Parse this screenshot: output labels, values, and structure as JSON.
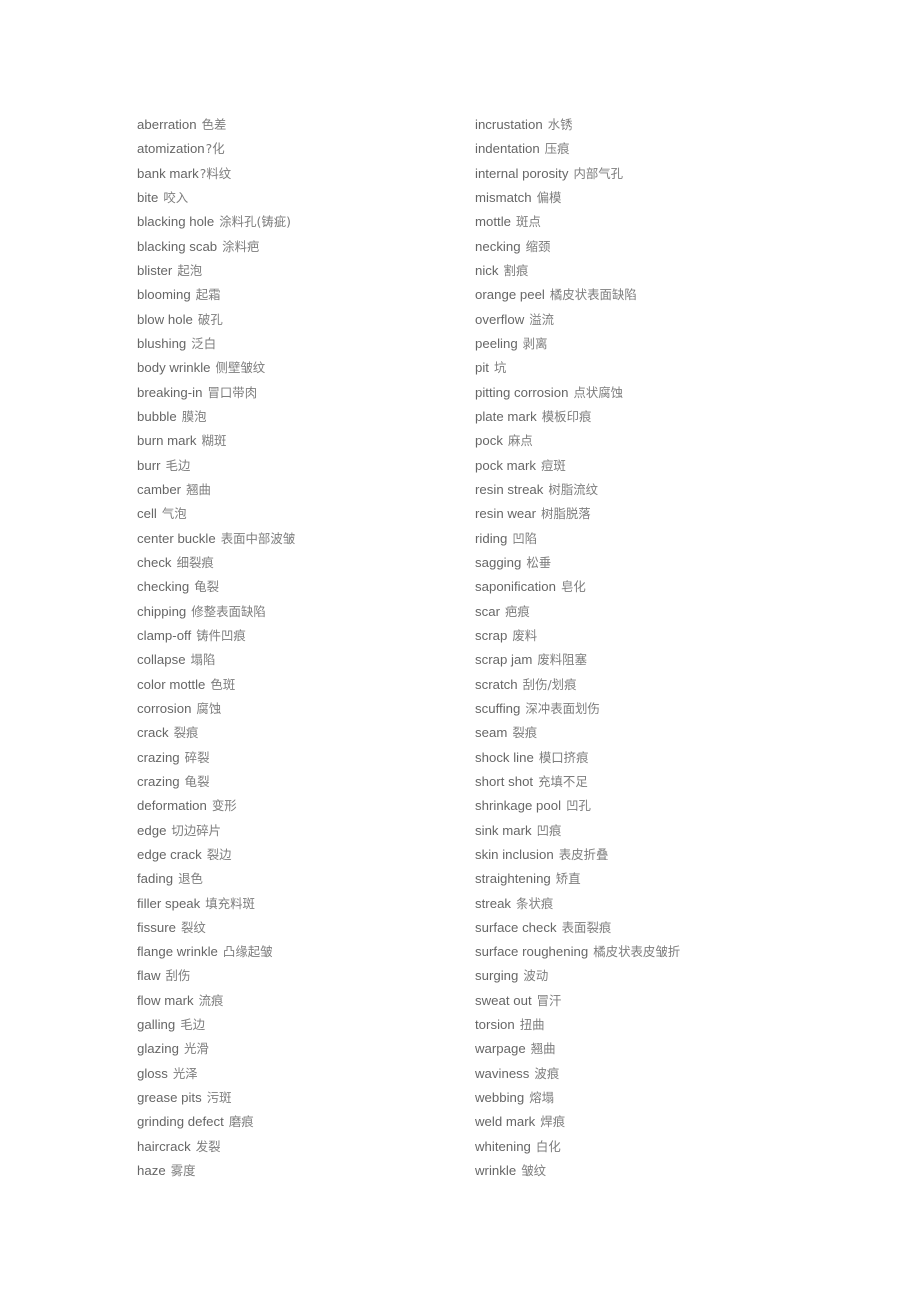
{
  "document": {
    "type": "bilingual-glossary",
    "language_pair": "English-Chinese",
    "columns": 2,
    "rows_per_column": 43,
    "text_color": "#666666",
    "background_color": "#ffffff"
  },
  "glossary": {
    "left_column": [
      {
        "term": "aberration",
        "gloss": "色差"
      },
      {
        "term": "atomization",
        "gloss": "?化",
        "tight": true
      },
      {
        "term": "bank mark",
        "gloss": "?料纹",
        "tight": true
      },
      {
        "term": "bite",
        "gloss": "咬入"
      },
      {
        "term": "blacking hole",
        "gloss": "涂料孔(铸疵)"
      },
      {
        "term": "blacking scab",
        "gloss": "涂料疤"
      },
      {
        "term": "blister",
        "gloss": "起泡"
      },
      {
        "term": "blooming",
        "gloss": "起霜"
      },
      {
        "term": "blow hole",
        "gloss": "破孔"
      },
      {
        "term": "blushing",
        "gloss": "泛白"
      },
      {
        "term": "body wrinkle",
        "gloss": "侧壁皱纹"
      },
      {
        "term": "breaking-in",
        "gloss": "冒口带肉"
      },
      {
        "term": "bubble",
        "gloss": "膜泡"
      },
      {
        "term": "burn mark",
        "gloss": "糊斑"
      },
      {
        "term": "burr",
        "gloss": "毛边"
      },
      {
        "term": "camber",
        "gloss": "翘曲"
      },
      {
        "term": "cell",
        "gloss": "气泡"
      },
      {
        "term": "center buckle",
        "gloss": "表面中部波皱"
      },
      {
        "term": "check",
        "gloss": "细裂痕"
      },
      {
        "term": "checking",
        "gloss": "龟裂"
      },
      {
        "term": "chipping",
        "gloss": "修整表面缺陷"
      },
      {
        "term": "clamp-off",
        "gloss": "铸件凹痕"
      },
      {
        "term": "collapse",
        "gloss": "塌陷"
      },
      {
        "term": "color mottle",
        "gloss": "色斑"
      },
      {
        "term": "corrosion",
        "gloss": "腐蚀"
      },
      {
        "term": "crack",
        "gloss": "裂痕"
      },
      {
        "term": "crazing",
        "gloss": "碎裂"
      },
      {
        "term": "crazing",
        "gloss": "龟裂"
      },
      {
        "term": "deformation",
        "gloss": "变形"
      },
      {
        "term": "edge",
        "gloss": "切边碎片"
      },
      {
        "term": "edge crack",
        "gloss": "裂边"
      },
      {
        "term": "fading",
        "gloss": "退色"
      },
      {
        "term": "filler speak",
        "gloss": "填充料斑"
      },
      {
        "term": "fissure",
        "gloss": "裂纹"
      },
      {
        "term": "flange wrinkle",
        "gloss": "凸缘起皱"
      },
      {
        "term": "flaw",
        "gloss": "刮伤"
      },
      {
        "term": "flow mark",
        "gloss": "流痕"
      },
      {
        "term": "galling",
        "gloss": "毛边"
      },
      {
        "term": "glazing",
        "gloss": "光滑"
      },
      {
        "term": "gloss",
        "gloss": "光泽"
      },
      {
        "term": "grease pits",
        "gloss": "污斑"
      },
      {
        "term": "grinding defect",
        "gloss": "磨痕"
      },
      {
        "term": "haircrack",
        "gloss": "发裂"
      },
      {
        "term": "haze",
        "gloss": "雾度"
      }
    ],
    "right_column": [
      {
        "term": "incrustation",
        "gloss": "水锈"
      },
      {
        "term": "indentation",
        "gloss": "压痕"
      },
      {
        "term": "internal porosity",
        "gloss": "内部气孔"
      },
      {
        "term": "mismatch",
        "gloss": "偏模"
      },
      {
        "term": "mottle",
        "gloss": "斑点"
      },
      {
        "term": "necking",
        "gloss": "缩颈"
      },
      {
        "term": "nick",
        "gloss": "割痕"
      },
      {
        "term": "orange peel",
        "gloss": "橘皮状表面缺陷"
      },
      {
        "term": "overflow",
        "gloss": "溢流"
      },
      {
        "term": "peeling",
        "gloss": "剥离"
      },
      {
        "term": "pit",
        "gloss": "坑"
      },
      {
        "term": "pitting corrosion",
        "gloss": "点状腐蚀"
      },
      {
        "term": "plate mark",
        "gloss": "模板印痕"
      },
      {
        "term": "pock",
        "gloss": "麻点"
      },
      {
        "term": "pock mark",
        "gloss": "痘斑"
      },
      {
        "term": "resin streak",
        "gloss": "树脂流纹"
      },
      {
        "term": "resin wear",
        "gloss": "树脂脱落"
      },
      {
        "term": "riding",
        "gloss": "凹陷"
      },
      {
        "term": "sagging",
        "gloss": "松垂"
      },
      {
        "term": "saponification",
        "gloss": "皂化"
      },
      {
        "term": "scar",
        "gloss": "疤痕"
      },
      {
        "term": "scrap",
        "gloss": "废料"
      },
      {
        "term": "scrap jam",
        "gloss": "废料阻塞"
      },
      {
        "term": "scratch",
        "gloss": "刮伤/划痕"
      },
      {
        "term": "scuffing",
        "gloss": "深冲表面划伤"
      },
      {
        "term": "seam",
        "gloss": "裂痕"
      },
      {
        "term": "shock line",
        "gloss": "模口挤痕"
      },
      {
        "term": "short shot",
        "gloss": "充填不足"
      },
      {
        "term": "shrinkage pool",
        "gloss": "凹孔"
      },
      {
        "term": "sink mark",
        "gloss": "凹痕"
      },
      {
        "term": "skin inclusion",
        "gloss": "表皮折叠"
      },
      {
        "term": "straightening",
        "gloss": "矫直"
      },
      {
        "term": "streak",
        "gloss": "条状痕"
      },
      {
        "term": "surface check",
        "gloss": "表面裂痕"
      },
      {
        "term": "surface roughening",
        "gloss": "橘皮状表皮皱折"
      },
      {
        "term": "surging",
        "gloss": "波动"
      },
      {
        "term": "sweat out",
        "gloss": "冒汗"
      },
      {
        "term": "torsion",
        "gloss": "扭曲"
      },
      {
        "term": "warpage",
        "gloss": "翘曲"
      },
      {
        "term": "waviness",
        "gloss": "波痕"
      },
      {
        "term": "webbing",
        "gloss": "熔塌"
      },
      {
        "term": "weld mark",
        "gloss": "焊痕"
      },
      {
        "term": "whitening",
        "gloss": "白化"
      },
      {
        "term": "wrinkle",
        "gloss": "皱纹"
      }
    ]
  }
}
